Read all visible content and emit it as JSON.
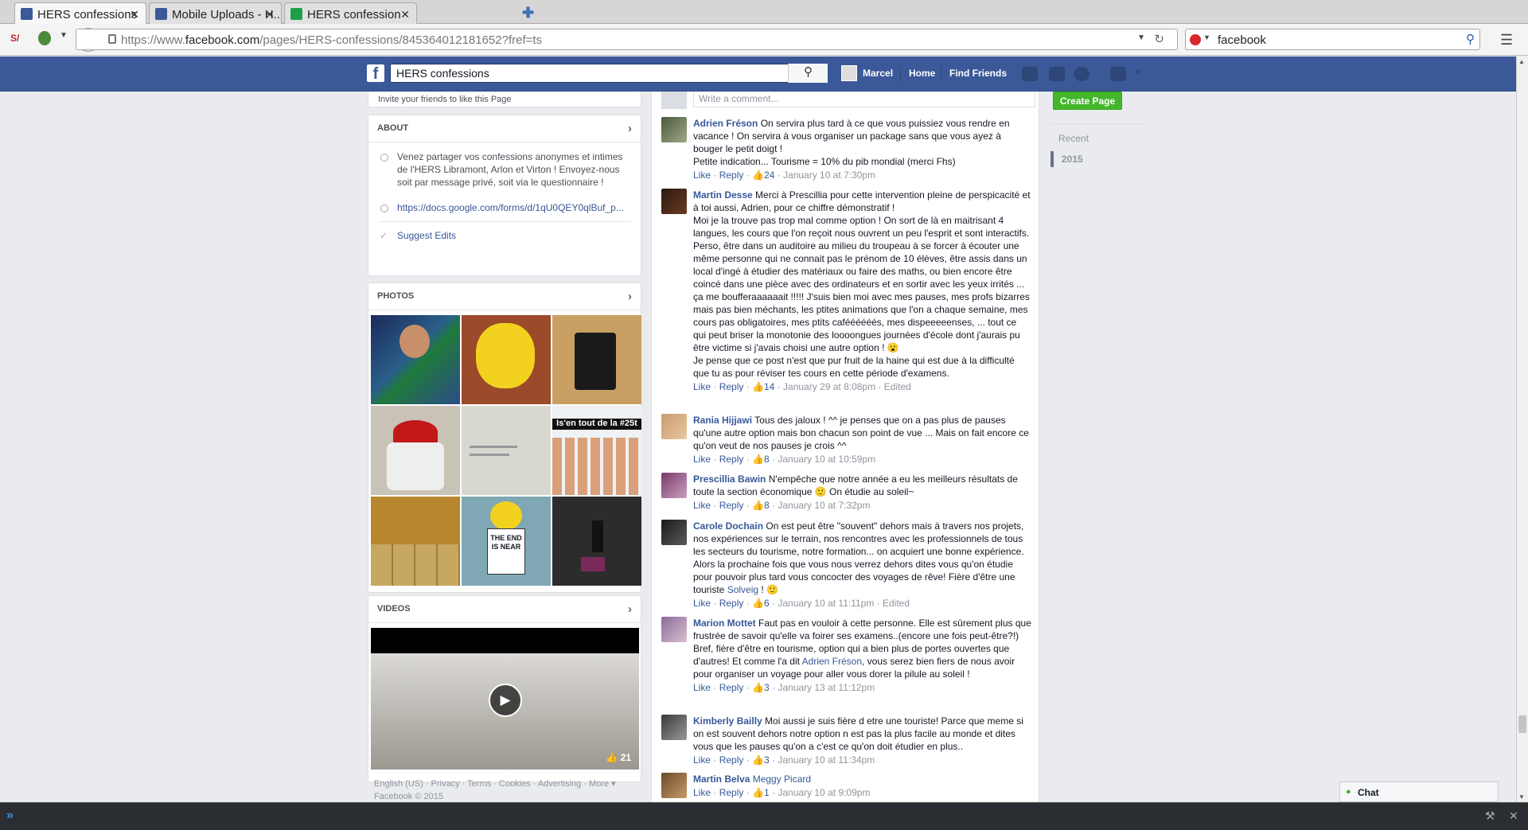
{
  "browser": {
    "tabs": [
      {
        "title": "HERS confessions",
        "active": true
      },
      {
        "title": "Mobile Uploads - H...",
        "active": false
      },
      {
        "title": "HERS confession",
        "active": false
      }
    ],
    "url_prefix": "https://www.",
    "url_domain": "facebook.com",
    "url_path": "/pages/HERS-confessions/845364012181652?fref=ts",
    "search_value": "facebook"
  },
  "fb": {
    "logo": "f",
    "search_value": "HERS confessions",
    "user_name": "Marcel",
    "home_label": "Home",
    "find_friends_label": "Find Friends"
  },
  "left": {
    "invite_text": "Invite your friends to like this Page",
    "about": {
      "header": "ABOUT",
      "description": "Venez partager vos confessions anonymes et intimes de l'HERS Libramont, Arlon et Virton ! Envoyez-nous soit par message privé, soit via le questionnaire !",
      "link": "https://docs.google.com/forms/d/1qU0QEY0qlBuf_p...",
      "suggest_edits": "Suggest Edits"
    },
    "photos_header": "PHOTOS",
    "photo_overlay_text": "Is'en tout de la #25t",
    "photo_sign_text": "THE END IS NEAR",
    "videos": {
      "header": "VIDEOS",
      "likes": "21"
    },
    "footer_links": [
      "English (US)",
      "Privacy",
      "Terms",
      "Cookies",
      "Advertising",
      "More"
    ],
    "copyright": "Facebook © 2015"
  },
  "comment_placeholder": "Write a comment...",
  "comments": [
    {
      "author": "Adrien Fréson",
      "text": "On servira plus tard à ce que vous puissiez vous rendre en vacance ! On servira à vous organiser un package sans que vous ayez à bouger le petit doigt !\nPetite indication... Tourisme = 10% du pib mondial (merci Fhs)",
      "likes": "24",
      "date": "January 10 at 7:30pm",
      "edited": ""
    },
    {
      "author": "Martin Desse",
      "text": "Merci à Prescillia pour cette intervention pleine de perspicacité et à toi aussi, Adrien, pour ce chiffre démonstratif !\nMoi je la trouve pas trop mal comme option ! On sort de là en maitrisant 4 langues, les cours que l'on reçoit nous ouvrent un peu l'esprit et sont interactifs. Perso, être dans un auditoire au milieu du troupeau à se forcer à écouter une même personne qui ne connait pas le prénom de 10 élèves, être assis dans un local d'ingé à étudier des matériaux ou faire des maths, ou bien encore être coincé dans une pièce avec des ordinateurs et en sortir avec les yeux irrités ... ça me boufferaaaaaait !!!!! J'suis bien moi avec mes pauses, mes profs bizarres mais pas bien méchants, les ptites animations que l'on a chaque semaine, mes cours pas obligatoires, mes ptits caféééééés, mes dispeeeeenses, ... tout ce qui peut briser la monotonie des loooongues journées d'école dont j'aurais pu être victime si j'avais choisi une autre option ! 😮\nJe pense que ce post n'est que pur fruit de la haine qui est due à la difficulté que tu as pour réviser tes cours en cette période d'examens.",
      "likes": "14",
      "date": "January 29 at 8:08pm",
      "edited": "Edited"
    },
    {
      "author": "Rania Hijjawi",
      "text": "Tous des jaloux ! ^^ je penses que on a pas plus de pauses qu'une autre option mais bon chacun son point de vue ... Mais on fait encore ce qu'on veut de nos pauses je crois ^^",
      "likes": "8",
      "date": "January 10 at 10:59pm",
      "edited": ""
    },
    {
      "author": "Prescillia Bawin",
      "text": "N'empêche que notre année a eu les meilleurs résultats de toute la section économique 🙂 On étudie au soleil~",
      "likes": "8",
      "date": "January 10 at 7:32pm",
      "edited": ""
    },
    {
      "author": "Carole Dochain",
      "text": "On est peut être \"souvent\" dehors mais à travers nos projets, nos expériences sur le terrain, nos rencontres avec les professionnels de tous les secteurs du tourisme, notre formation... on acquiert une bonne expérience. Alors la prochaine fois que vous nous verrez dehors dites vous qu'on étudie pour pouvoir plus tard vous concocter des voyages de rêve! Fière d'être une touriste",
      "mention": "Solveig",
      "text_after": " ! 🙂",
      "likes": "6",
      "date": "January 10 at 11:11pm",
      "edited": "Edited"
    },
    {
      "author": "Marion Mottet",
      "text": "Faut pas en vouloir à cette personne. Elle est sûrement plus que frustrée de savoir qu'elle va foirer ses examens..(encore une fois peut-être?!)\nBref, fière d'être en tourisme, option qui a bien plus de portes ouvertes que d'autres! Et comme l'a dit",
      "mention": "Adrien Fréson",
      "text_after": ", vous serez bien fiers de nous avoir pour organiser un voyage pour aller vous dorer la pilule au soleil !",
      "likes": "3",
      "date": "January 13 at 11:12pm",
      "edited": ""
    },
    {
      "author": "Kimberly Bailly",
      "text": "Moi aussi je suis fière d etre une touriste! Parce que meme si on est souvent dehors notre option n est pas la plus facile au monde et dites vous que les pauses qu'on a c'est ce qu'on doit étudier en plus..",
      "likes": "3",
      "date": "January 10 at 11:34pm",
      "edited": ""
    },
    {
      "author": "Martin Belva",
      "text": "",
      "mention": "Meggy Picard",
      "text_after": "",
      "likes": "1",
      "date": "January 10 at 9:09pm",
      "edited": ""
    }
  ],
  "comment_actions": {
    "like": "Like",
    "reply": "Reply"
  },
  "right": {
    "create_page": "Create Page",
    "timeline": [
      "Recent",
      "2015"
    ]
  },
  "chat_label": "Chat",
  "colors": {
    "fb_blue": "#3b5998",
    "link": "#365899",
    "green": "#42b72a"
  }
}
